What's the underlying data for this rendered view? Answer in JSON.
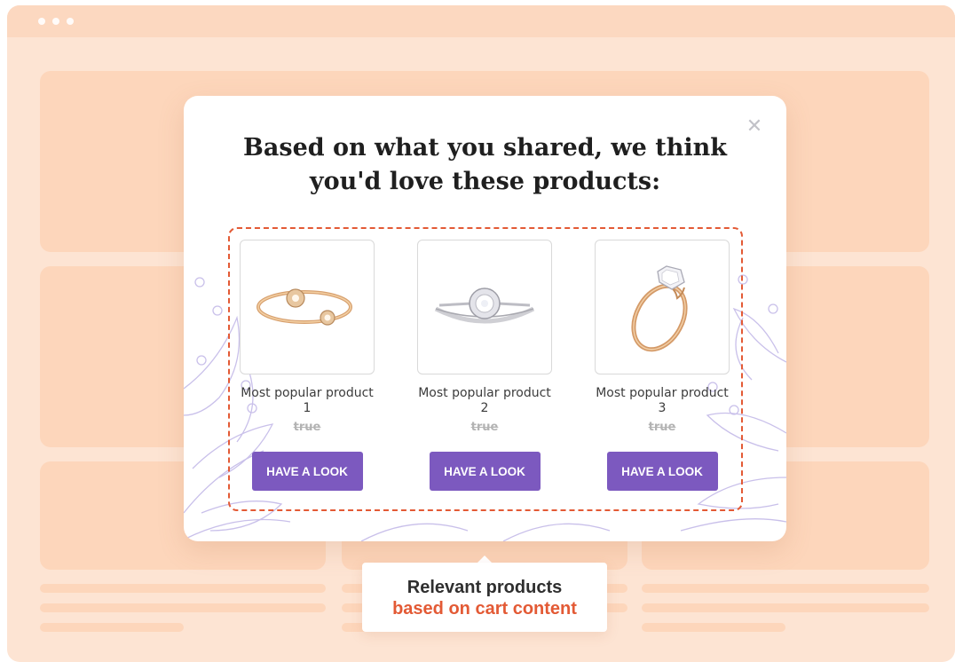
{
  "headline": "Based on what you shared, we think you'd love these products:",
  "close_icon": "close-icon",
  "products": [
    {
      "name": "Most popular product 1",
      "price": "true",
      "button": "HAVE A LOOK",
      "image": "open-ring-icon"
    },
    {
      "name": "Most popular product 2",
      "price": "true",
      "button": "HAVE A LOOK",
      "image": "halo-ring-icon"
    },
    {
      "name": "Most popular product 3",
      "price": "true",
      "button": "HAVE A LOOK",
      "image": "solitaire-ring-icon"
    }
  ],
  "callout": {
    "line1": "Relevant products",
    "line2": "based on cart content"
  },
  "colors": {
    "background": "#fde4d3",
    "placeholder": "#fdd6bb",
    "button": "#7c59bf",
    "accent": "#e35a35"
  }
}
